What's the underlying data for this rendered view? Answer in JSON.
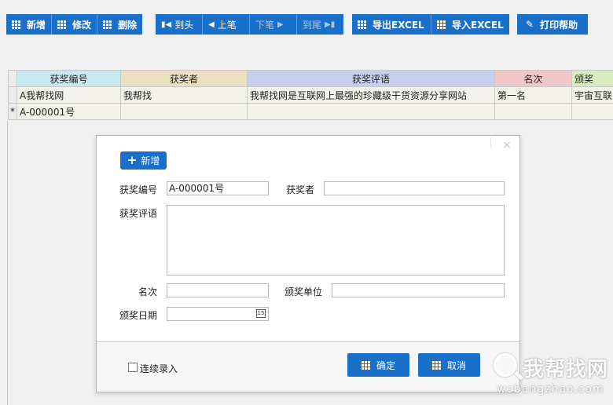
{
  "toolbar": {
    "add": "新增",
    "edit": "修改",
    "delete": "删除",
    "first": "到头",
    "prev": "上笔",
    "next": "下笔",
    "last": "到尾",
    "export_excel": "导出EXCEL",
    "import_excel": "导入EXCEL",
    "print_help": "打印帮助"
  },
  "grid": {
    "columns": [
      "获奖编号",
      "获奖者",
      "获奖评语",
      "名次",
      "颁奖"
    ],
    "rows": [
      {
        "marker": "",
        "cells": [
          "A我帮找网",
          "我帮找",
          "我帮找网是互联网上最强的珍藏级干货资源分享网站",
          "第一名",
          "宇宙互联网"
        ]
      },
      {
        "marker": "*",
        "cells": [
          "A-000001号",
          "",
          "",
          "",
          ""
        ]
      }
    ]
  },
  "dialog": {
    "close": "×",
    "add_button": "新增",
    "labels": {
      "award_no": "获奖编号",
      "winner": "获奖者",
      "comment": "获奖评语",
      "rank": "名次",
      "org": "颁奖单位",
      "date": "颁奖日期"
    },
    "values": {
      "award_no": "A-000001号",
      "winner": "",
      "comment": "",
      "rank": "",
      "org": "",
      "date": ""
    },
    "calendar_icon_text": "15",
    "continuous_label": "连续录入",
    "ok": "确定",
    "cancel": "取消"
  },
  "watermark": {
    "title": "我帮找网",
    "url": "wobangzhao.com"
  },
  "colors": {
    "accent": "#1a6fc9",
    "col1": "#c7e9ef",
    "col2": "#eadfc1",
    "col3": "#c7cfee",
    "col4": "#efc8c8",
    "col5": "#d8ecc2"
  }
}
